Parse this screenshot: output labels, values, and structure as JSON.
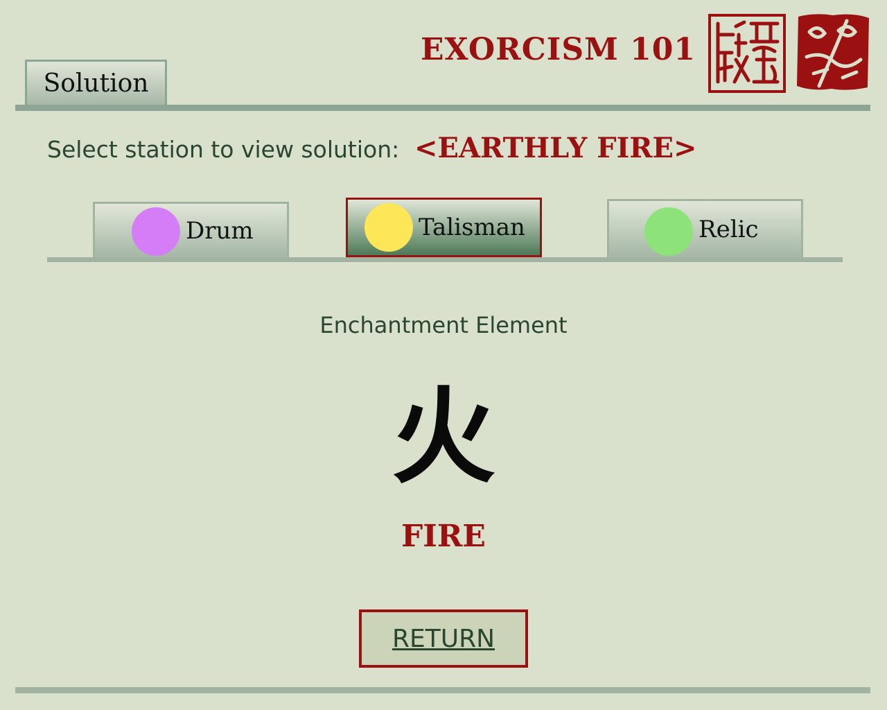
{
  "header": {
    "tab_label": "Solution",
    "game_title": "EXORCISM 101"
  },
  "stations": {
    "prompt": "Select station to view solution:",
    "current": "<EARTHLY FIRE>",
    "tabs": [
      {
        "label": "Drum",
        "color": "#d57df6",
        "selected": false
      },
      {
        "label": "Talisman",
        "color": "#fde657",
        "selected": true
      },
      {
        "label": "Relic",
        "color": "#8ee27a",
        "selected": false
      }
    ]
  },
  "solution": {
    "heading": "Enchantment Element",
    "glyph": "火",
    "element": "FIRE"
  },
  "footer": {
    "return_label": "RETURN"
  },
  "colors": {
    "accent": "#9b1010",
    "text": "#2b4630",
    "background": "#d9e0cb"
  }
}
